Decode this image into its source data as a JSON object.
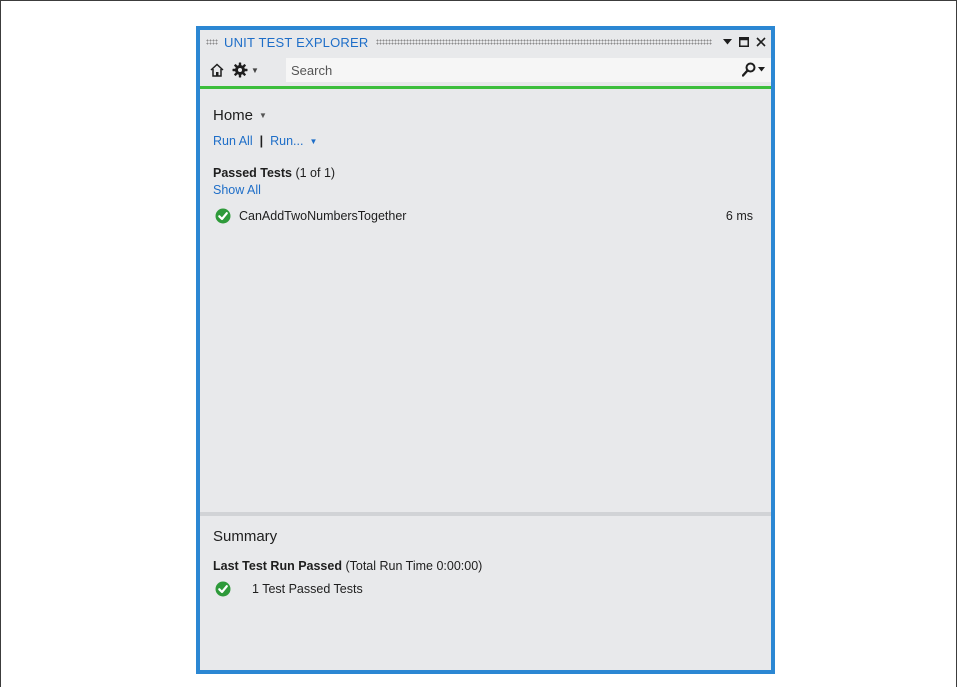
{
  "window": {
    "title": "UNIT TEST EXPLORER"
  },
  "toolbar": {
    "search_placeholder": "Search",
    "icons": [
      "home-icon",
      "settings-icon",
      "dropdown-caret-icon",
      "search-icon"
    ]
  },
  "content": {
    "home_label": "Home",
    "run_all_label": "Run All",
    "run_label": "Run...",
    "separator": "|",
    "passed_tests_label": "Passed Tests",
    "passed_tests_count": "(1 of 1)",
    "show_all_label": "Show All",
    "tests": [
      {
        "name": "CanAddTwoNumbersTogether",
        "duration": "6 ms",
        "status": "passed"
      }
    ]
  },
  "summary": {
    "title": "Summary",
    "last_run_label": "Last Test Run Passed",
    "last_run_detail": "(Total Run Time 0:00:00)",
    "result_text": "1 Test Passed Tests"
  },
  "colors": {
    "window_border": "#2b87d3",
    "accent_bar": "#3cbe3c",
    "link": "#1e6ec8",
    "pass_icon": "#2e9a3a",
    "panel_bg": "#e8e9eb"
  }
}
